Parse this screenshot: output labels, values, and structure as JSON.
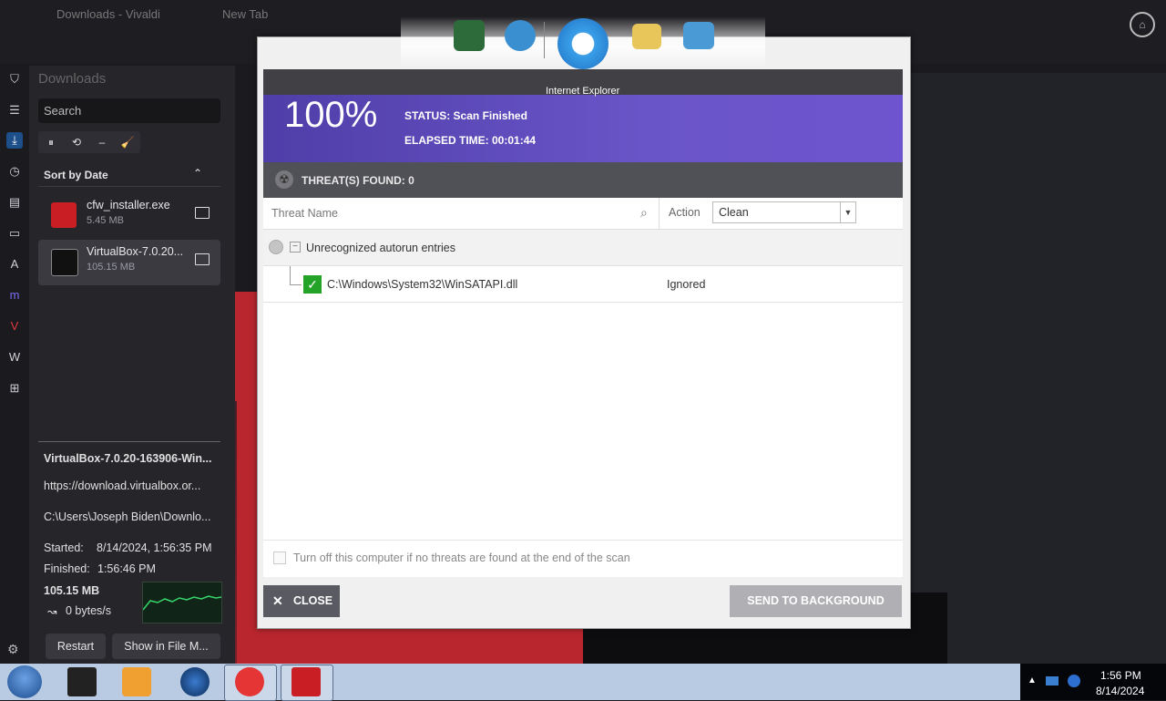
{
  "browser": {
    "tab_title": "Downloads - Vivaldi",
    "tab2": "New Tab"
  },
  "downloads": {
    "panel_title": "Downloads",
    "search_placeholder": "Search",
    "toolbar": [
      "⏸",
      "⟲",
      "–",
      "🧹"
    ],
    "sort_label": "Sort by Date",
    "items": [
      {
        "name": "cfw_installer.exe",
        "size": "5.45 MB",
        "icon": "comodo-red-icon"
      },
      {
        "name": "VirtualBox-7.0.20...",
        "size": "105.15 MB",
        "icon": "virtualbox-icon"
      }
    ],
    "detail": {
      "filename": "VirtualBox-7.0.20-163906-Win...",
      "url": "https://download.virtualbox.or...",
      "path": "C:\\Users\\Joseph Biden\\Downlo...",
      "started_label": "Started:",
      "started": "8/14/2024, 1:56:35 PM",
      "finished_label": "Finished:",
      "finished": "1:56:46 PM",
      "size": "105.15 MB",
      "speed": "0 bytes/s"
    },
    "restart": "Restart",
    "show_in_file": "Show in File M..."
  },
  "dialog": {
    "percent": "100%",
    "status": "STATUS: Scan Finished",
    "elapsed": "ELAPSED TIME: 00:01:44",
    "threats_found": "THREAT(S) FOUND: 0",
    "col_threat": "Threat Name",
    "col_action": "Action",
    "action_value": "Clean",
    "group": "Unrecognized autorun entries",
    "entry_path": "C:\\Windows\\System32\\WinSATAPI.dll",
    "entry_status": "Ignored",
    "turn_off_label": "Turn off this computer if no threats are found at the end of the scan",
    "close": "CLOSE",
    "send_bg": "SEND TO BACKGROUND"
  },
  "dock": {
    "tooltip": "Internet Explorer"
  },
  "tray": {
    "time": "1:56 PM",
    "date": "8/14/2024"
  }
}
